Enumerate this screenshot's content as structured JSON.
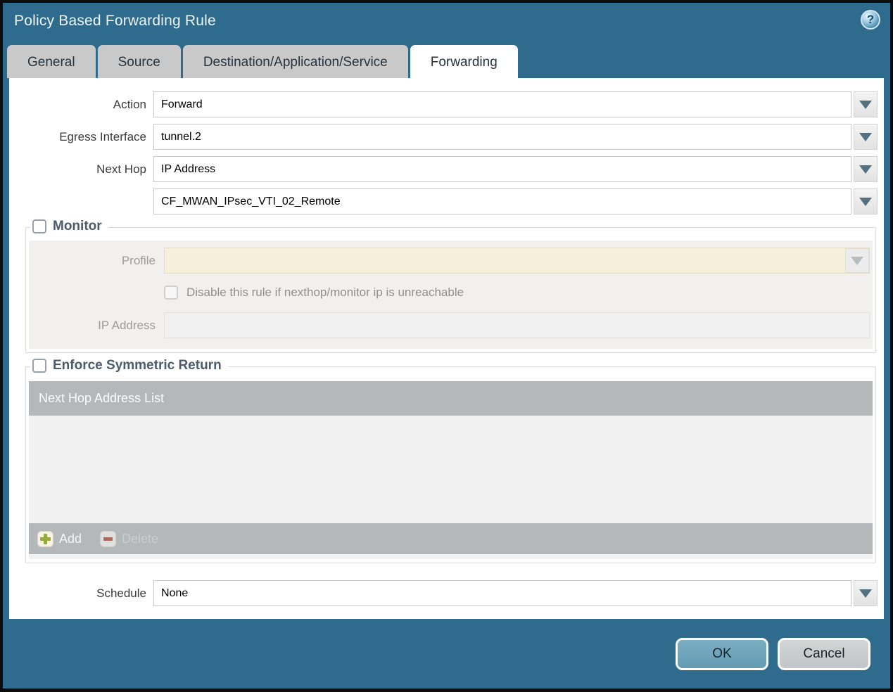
{
  "dialog": {
    "title": "Policy Based Forwarding Rule",
    "help_icon_glyph": "?"
  },
  "tabs": [
    {
      "label": "General",
      "active": false
    },
    {
      "label": "Source",
      "active": false
    },
    {
      "label": "Destination/Application/Service",
      "active": false
    },
    {
      "label": "Forwarding",
      "active": true
    }
  ],
  "form": {
    "action": {
      "label": "Action",
      "value": "Forward"
    },
    "egress_interface": {
      "label": "Egress Interface",
      "value": "tunnel.2"
    },
    "next_hop": {
      "label": "Next Hop",
      "value": "IP Address"
    },
    "next_hop_address": {
      "value": "CF_MWAN_IPsec_VTI_02_Remote"
    },
    "schedule": {
      "label": "Schedule",
      "value": "None"
    }
  },
  "monitor": {
    "legend": "Monitor",
    "checked": false,
    "profile": {
      "label": "Profile",
      "value": ""
    },
    "disable_rule_checkbox": {
      "label": "Disable this rule if nexthop/monitor ip is unreachable",
      "checked": false
    },
    "ip_address": {
      "label": "IP Address",
      "value": ""
    }
  },
  "symmetric_return": {
    "legend": "Enforce Symmetric Return",
    "checked": false,
    "table": {
      "header": "Next Hop Address List",
      "rows": []
    },
    "add_label": "Add",
    "delete_label": "Delete"
  },
  "footer": {
    "ok_label": "OK",
    "cancel_label": "Cancel"
  },
  "colors": {
    "frame_teal": "#2e6b8c",
    "ok_button": "#6ea4ba",
    "cancel_button": "#c9cccd",
    "inactive_tab": "#c9c9c9",
    "table_chrome": "#b4b8ba",
    "profile_disabled_bg": "#f5efdc",
    "legend_text": "#4c5b6b",
    "add_icon_green": "#95a93f",
    "delete_icon_red": "#aa6a62"
  }
}
